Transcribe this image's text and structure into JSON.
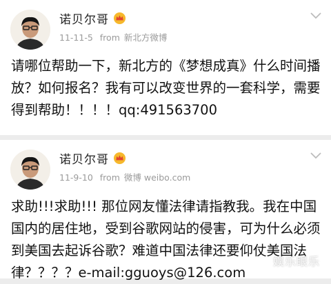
{
  "posts": [
    {
      "author": "诺贝尔哥",
      "time": "11-11-5",
      "source_prefix": "from",
      "source": "新北方微博",
      "text": "请哪位帮助一下，新北方的《梦想成真》什么时间播放？如何报名？我有可以改变世界的一套科学，需要得到帮助！！！！qq:491563700"
    },
    {
      "author": "诺贝尔哥",
      "time": "11-9-10",
      "source_prefix": "from",
      "source": "微博 weibo.com",
      "text": "求助!!!求助!!!  那位网友懂法律请指教我。我在中国国内的居住地，受到谷歌网站的侵害，可为什么必须到美国去起诉谷歌？难道中国法律还要仰仗美国法律？？？？e-mail:gguoys@126.com"
    }
  ],
  "watermark": "娱乐眼乐"
}
